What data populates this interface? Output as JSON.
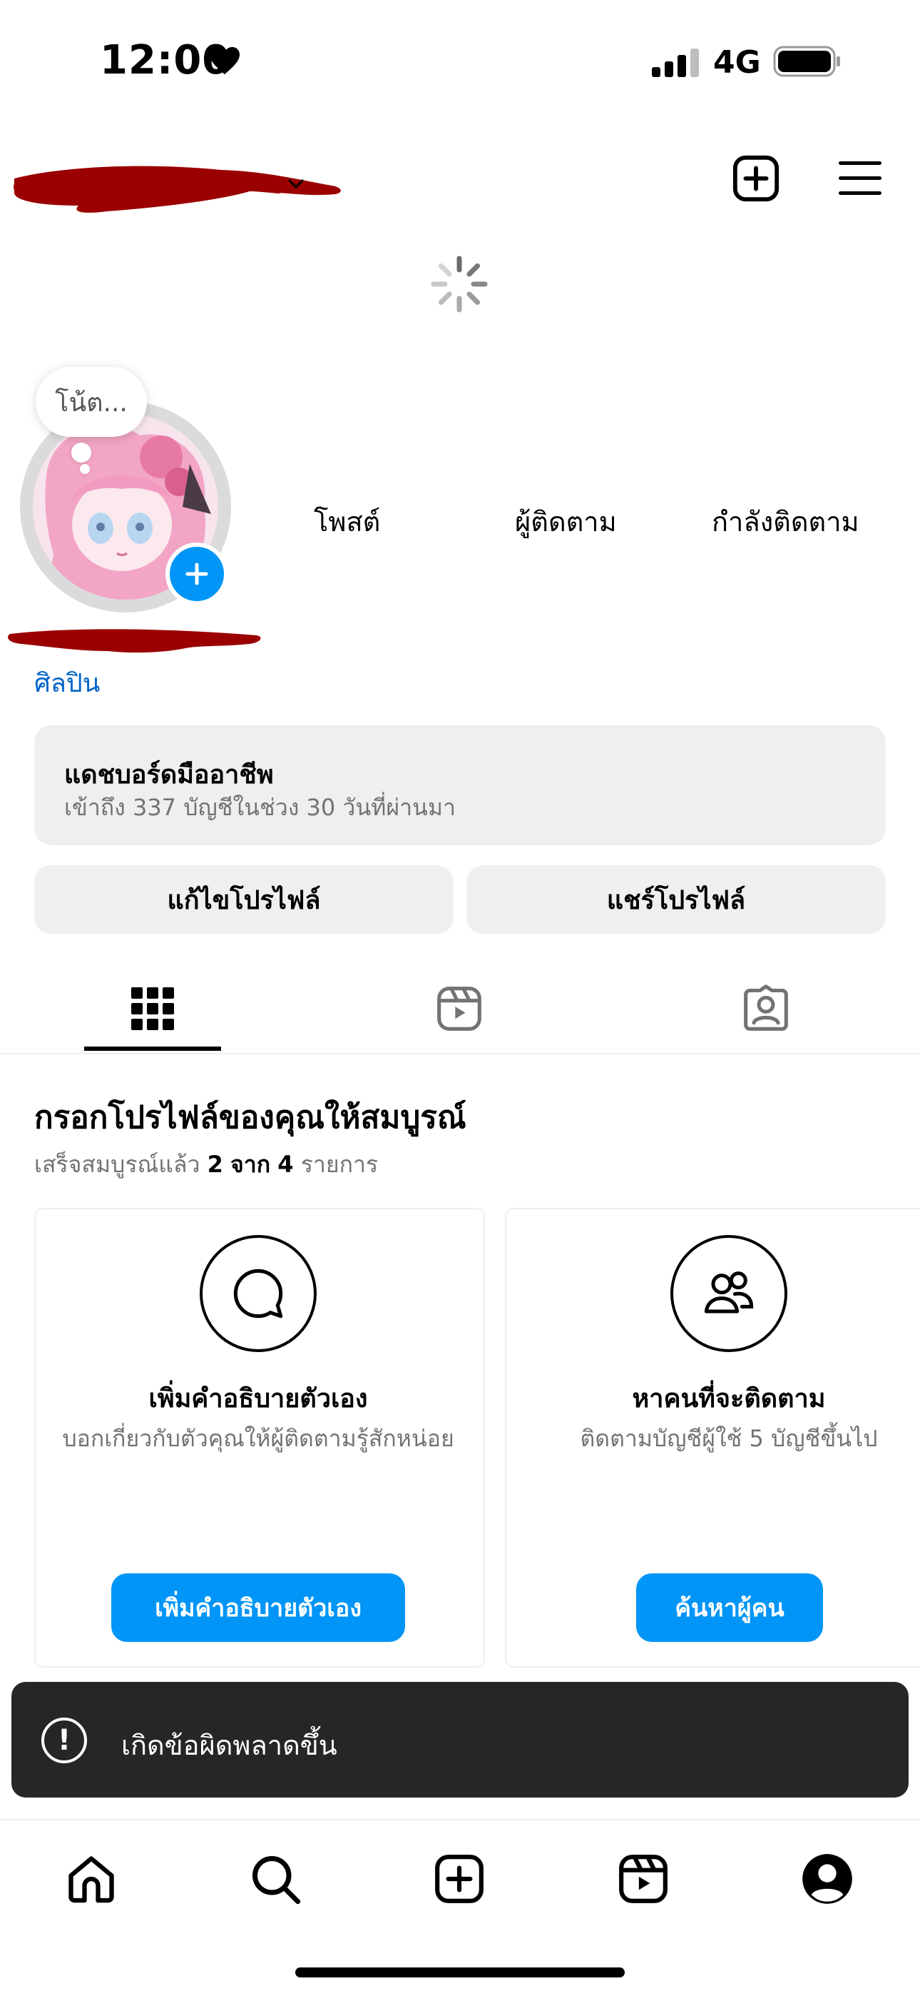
{
  "status_bar": {
    "time": "12:00",
    "network": "4G"
  },
  "header": {
    "spinner_icon": "loading-spinner"
  },
  "profile": {
    "note": "โน้ต...",
    "stats": {
      "posts": "โพสต์",
      "followers": "ผู้ติดตาม",
      "following": "กำลังติดตาม"
    },
    "category": "ศิลปิน"
  },
  "dashboard": {
    "title": "แดชบอร์ดมืออาชีพ",
    "subtitle": "เข้าถึง 337 บัญชีในช่วง 30 วันที่ผ่านมา"
  },
  "buttons": {
    "edit": "แก้ไขโปรไฟล์",
    "share": "แชร์โปรไฟล์"
  },
  "tabs": [
    "grid-icon",
    "reels-icon",
    "tagged-icon"
  ],
  "complete_profile": {
    "title": "กรอกโปรไฟล์ของคุณให้สมบูรณ์",
    "progress_prefix": "เสร็จสมบูรณ์แล้ว",
    "progress_done": "2",
    "progress_of": "จาก",
    "progress_total": "4",
    "progress_suffix": "รายการ",
    "cards": [
      {
        "title": "เพิ่มคำอธิบายตัวเอง",
        "desc": "บอกเกี่ยวกับตัวคุณให้ผู้ติดตามรู้สักหน่อย",
        "button": "เพิ่มคำอธิบายตัวเอง"
      },
      {
        "title": "หาคนที่จะติดตาม",
        "desc": "ติดตามบัญชีผู้ใช้ 5 บัญชีขึ้นไป",
        "button": "ค้นหาผู้คน"
      }
    ]
  },
  "toast": {
    "message": "เกิดข้อผิดพลาดขึ้น"
  },
  "bottom_nav": [
    "home-icon",
    "search-icon",
    "create-icon",
    "reels-icon",
    "profile-icon"
  ],
  "colors": {
    "accent": "#0095f6",
    "redaction": "#9b0000",
    "toast_bg": "#262626"
  }
}
